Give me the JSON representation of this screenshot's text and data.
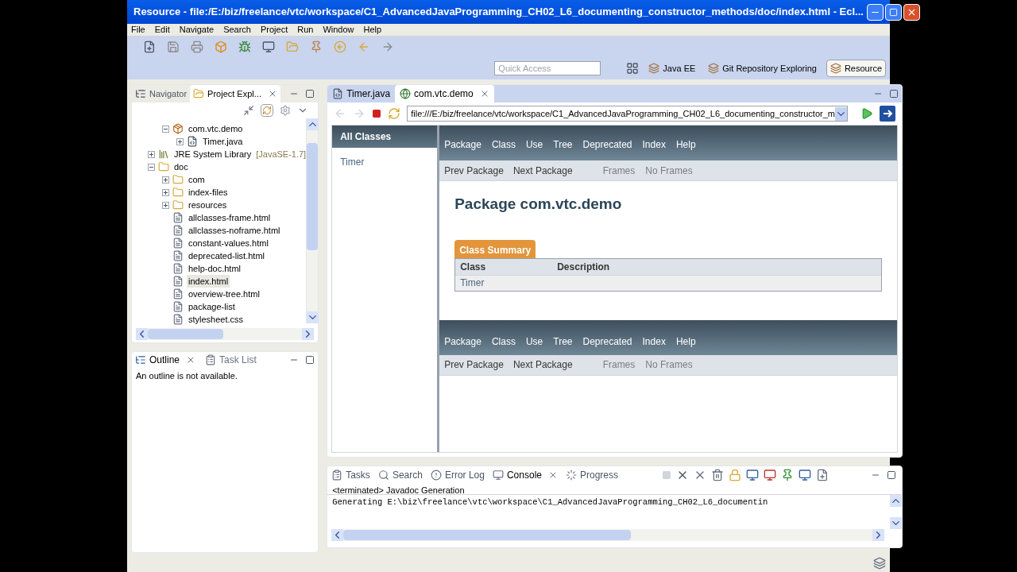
{
  "window": {
    "title": "Resource - file:/E:/biz/freelance/vtc/workspace/C1_AdvancedJavaProgramming_CH02_L6_documenting_constructor_methods/doc/index.html - Ecl..."
  },
  "menu": [
    "File",
    "Edit",
    "Navigate",
    "Search",
    "Project",
    "Run",
    "Window",
    "Help"
  ],
  "quick_access": {
    "placeholder": "Quick Access"
  },
  "perspectives": [
    {
      "label": "Java EE",
      "selected": false
    },
    {
      "label": "Git Repository Exploring",
      "selected": false
    },
    {
      "label": "Resource",
      "selected": true
    }
  ],
  "left_tabs": [
    {
      "label": "Navigator",
      "selected": false
    },
    {
      "label": "Project Expl...",
      "selected": true
    }
  ],
  "tree": [
    {
      "label": "com.vtc.demo",
      "kind": "package",
      "expanded": true,
      "children": [
        {
          "label": "Timer.java",
          "kind": "java",
          "expanded": false
        }
      ]
    },
    {
      "label": "JRE System Library",
      "decoration": "[JavaSE-1.7]",
      "kind": "library",
      "expanded": false
    },
    {
      "label": "doc",
      "kind": "folder",
      "expanded": true,
      "children": [
        {
          "label": "com",
          "kind": "folder",
          "expanded": false
        },
        {
          "label": "index-files",
          "kind": "folder",
          "expanded": false
        },
        {
          "label": "resources",
          "kind": "folder",
          "expanded": false
        },
        {
          "label": "allclasses-frame.html",
          "kind": "file",
          "selected": false
        },
        {
          "label": "allclasses-noframe.html",
          "kind": "file",
          "selected": false
        },
        {
          "label": "constant-values.html",
          "kind": "file",
          "selected": false
        },
        {
          "label": "deprecated-list.html",
          "kind": "file",
          "selected": false
        },
        {
          "label": "help-doc.html",
          "kind": "file",
          "selected": false
        },
        {
          "label": "index.html",
          "kind": "file",
          "selected": true
        },
        {
          "label": "overview-tree.html",
          "kind": "file",
          "selected": false
        },
        {
          "label": "package-list",
          "kind": "file",
          "selected": false
        },
        {
          "label": "stylesheet.css",
          "kind": "file",
          "selected": false
        }
      ]
    }
  ],
  "outline_tabs": [
    {
      "label": "Outline",
      "selected": true
    },
    {
      "label": "Task List",
      "selected": false
    }
  ],
  "outline_message": "An outline is not available.",
  "editor_tabs": [
    {
      "label": "Timer.java",
      "selected": false
    },
    {
      "label": "com.vtc.demo",
      "selected": true
    }
  ],
  "url": "file:///E:/biz/freelance/vtc/workspace/C1_AdvancedJavaProgramming_CH02_L6_documenting_constructor_m",
  "javadoc": {
    "frame_title": "All Classes",
    "frame_items": [
      "Timer"
    ],
    "nav": [
      "Package",
      "Class",
      "Use",
      "Tree",
      "Deprecated",
      "Index",
      "Help"
    ],
    "subnav_left": [
      "Prev Package",
      "Next Package"
    ],
    "subnav_right": [
      "Frames",
      "No Frames"
    ],
    "heading": "Package com.vtc.demo",
    "summary_caption": "Class Summary",
    "table": {
      "columns": [
        "Class",
        "Description"
      ],
      "rows": [
        [
          "Timer"
        ]
      ]
    },
    "bottom_nav": [
      "Package",
      "Class",
      "Use",
      "Tree",
      "Deprecated",
      "Index",
      "Help"
    ],
    "bottom_subnav_left": [
      "Prev Package",
      "Next Package"
    ],
    "bottom_subnav_right": [
      "Frames",
      "No Frames"
    ]
  },
  "console_tabs": [
    {
      "label": "Tasks",
      "selected": false
    },
    {
      "label": "Search",
      "selected": false
    },
    {
      "label": "Error Log",
      "selected": false
    },
    {
      "label": "Console",
      "selected": true
    },
    {
      "label": "Progress",
      "selected": false
    }
  ],
  "console": {
    "process": "<terminated> Javadoc Generation",
    "output": "Generating E:\\biz\\freelance\\vtc\\workspace\\C1_AdvancedJavaProgramming_CH02_L6_documentin"
  }
}
